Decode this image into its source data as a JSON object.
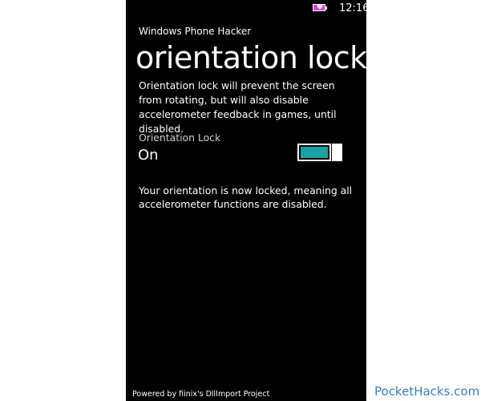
{
  "status_bar": {
    "time": "12:16",
    "battery_color": "#e040e0"
  },
  "app": {
    "title": "Windows Phone Hacker",
    "page_title": "orientation lock",
    "description": "Orientation lock will prevent the screen from rotating, but will also disable accelerometer feedback in games, until disabled."
  },
  "toggle": {
    "label": "Orientation Lock",
    "value": "On",
    "state": true,
    "accent_color": "#1ba1a1"
  },
  "status_message": "Your orientation is now locked, meaning all accelerometer functions are disabled.",
  "footer": "Powered by fiinix's DllImport Project",
  "watermark": "PocketHacks.com"
}
